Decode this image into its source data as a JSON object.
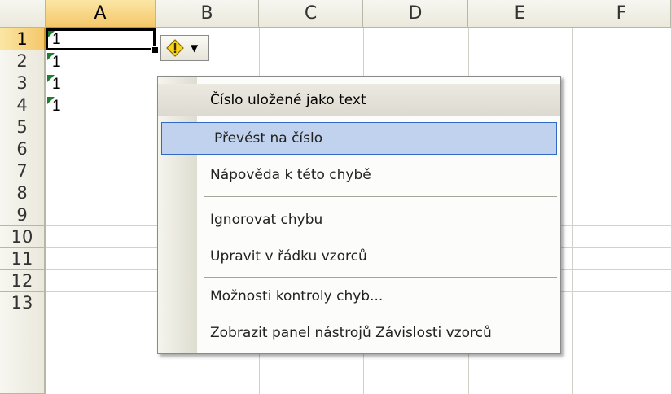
{
  "columns": [
    "A",
    "B",
    "C",
    "D",
    "E",
    "F"
  ],
  "rows": [
    "1",
    "2",
    "3",
    "4",
    "5",
    "6",
    "7",
    "8",
    "9",
    "10",
    "11",
    "12",
    "13"
  ],
  "cells": [
    "1",
    "1",
    "1",
    "1"
  ],
  "menu": {
    "header": "Číslo uložené jako text",
    "items": [
      "Převést na číslo",
      "Nápověda k této chybě",
      "Ignorovat chybu",
      "Upravit v řádku vzorců",
      "Možnosti kontroly chyb...",
      "Zobrazit panel nástrojů Závislosti vzorců"
    ]
  },
  "icons": {
    "smart_tag": "warning-diamond-icon",
    "dropdown": "chevron-down-icon"
  },
  "colors": {
    "error_indicator": "#1e7d32",
    "smart_tag_icon": "#f7d41b",
    "selection_highlight": "#c1d2ee"
  }
}
